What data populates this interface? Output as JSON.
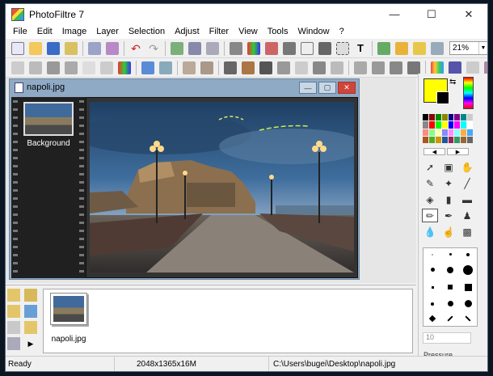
{
  "app": {
    "title": "PhotoFiltre 7",
    "window_controls": [
      "minimize-icon",
      "maximize-icon",
      "close-icon"
    ]
  },
  "menu": [
    "File",
    "Edit",
    "Image",
    "Layer",
    "Selection",
    "Adjust",
    "Filter",
    "View",
    "Tools",
    "Window",
    "?"
  ],
  "toolbar": {
    "zoom": "21%"
  },
  "document": {
    "title": "napoli.jpg",
    "layer_label": "Background"
  },
  "open_documents": [
    {
      "name": "napoli.jpg"
    }
  ],
  "colors": {
    "foreground": "#ffff00",
    "background": "#000000"
  },
  "brush": {
    "size": "10",
    "pressure_label": "Pressure"
  },
  "status": {
    "state": "Ready",
    "dimensions": "2048x1365x16M",
    "path": "C:\\Users\\bugei\\Desktop\\napoli.jpg"
  }
}
